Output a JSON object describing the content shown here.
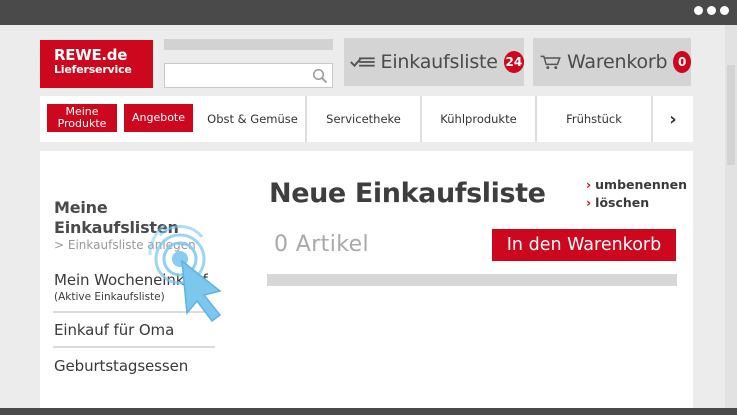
{
  "header": {
    "logo_main": "REWE.de",
    "logo_sub": "Lieferservice",
    "shopping_list_label": "Einkaufsliste",
    "shopping_list_count": "24",
    "cart_label": "Warenkorb",
    "cart_count": "0"
  },
  "nav": {
    "my_products": "Meine Produkte",
    "offers": "Angebote",
    "items": [
      "Obst & Gemüse",
      "Servicetheke",
      "Kühlprodukte",
      "Frühstück"
    ],
    "next_arrow": "›"
  },
  "sidebar": {
    "title": "Meine Einkaufslisten",
    "create_link": "> Einkaufsliste anlegen",
    "lists": [
      {
        "label": "Mein Wocheneinkauf",
        "note": "(Aktive Einkaufsliste)"
      },
      {
        "label": "Einkauf für Oma"
      },
      {
        "label": "Geburtstagsessen"
      }
    ]
  },
  "main": {
    "title": "Neue Einkaufsliste",
    "rename_link": "umbenennen",
    "delete_link": "löschen",
    "article_count": "0 Artikel",
    "add_to_cart_button": "In den Warenkorb"
  },
  "colors": {
    "brand_red": "#cc071e",
    "cursor_blue": "#7cc7ee"
  },
  "icons": [
    "list-icon",
    "cart-icon",
    "search-icon",
    "click-cursor-icon"
  ]
}
